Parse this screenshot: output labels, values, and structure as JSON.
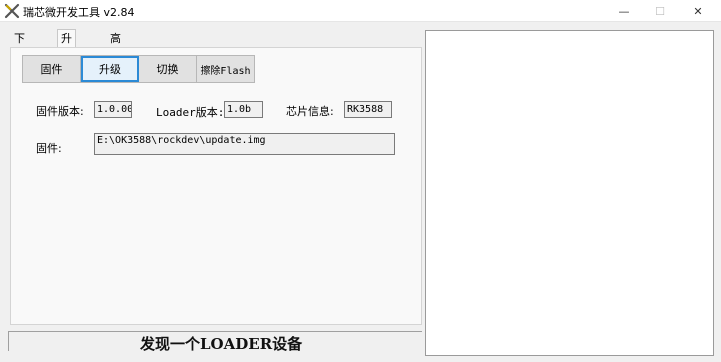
{
  "window": {
    "title": "瑞芯微开发工具 v2.84",
    "minimize_glyph": "—",
    "maximize_glyph": "☐",
    "close_glyph": "✕",
    "icon": "rockchip-tool-icon"
  },
  "tabs": [
    {
      "label": "下载镜像",
      "selected": false
    },
    {
      "label": "升级固件",
      "selected": true
    },
    {
      "label": "高级功能",
      "selected": false
    }
  ],
  "toolbar": {
    "firmware_label": "固件",
    "upgrade_label": "升级",
    "switch_label": "切换",
    "erase_label": "擦除Flash"
  },
  "info": {
    "firmware_version_label": "固件版本:",
    "firmware_version_value": "1.0.00",
    "loader_version_label": "Loader版本:",
    "loader_version_value": "1.0b",
    "chip_info_label": "芯片信息:",
    "chip_info_value": "RK3588",
    "firmware_path_label": "固件:",
    "firmware_path_value": "E:\\OK3588\\rockdev\\update.img"
  },
  "status": {
    "text": "发现一个LOADER设备"
  },
  "colors": {
    "active_border": "#2b8ad6",
    "active_fill": "#e5f1fb",
    "panel_bg": "#f9f9f9",
    "window_bg": "#f0f0f0"
  }
}
